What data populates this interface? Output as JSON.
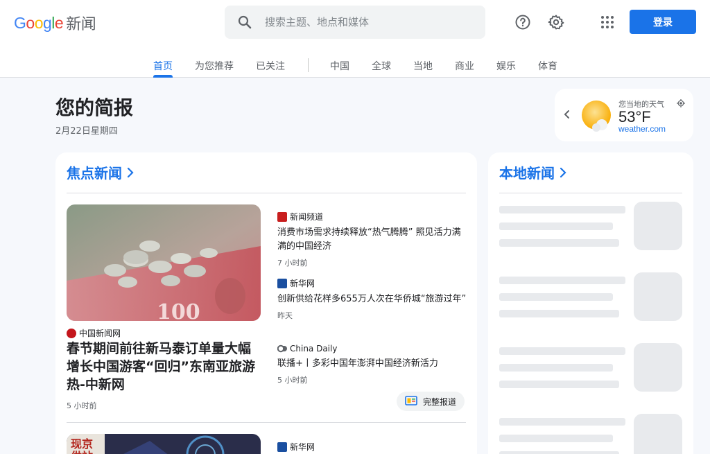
{
  "header": {
    "logo_letters": [
      "G",
      "o",
      "o",
      "g",
      "l",
      "e"
    ],
    "product_name": "新闻",
    "search_placeholder": "搜索主题、地点和媒体",
    "login_label": "登录"
  },
  "tabs": [
    {
      "label": "首页",
      "active": true
    },
    {
      "label": "为您推荐",
      "active": false
    },
    {
      "label": "已关注",
      "active": false
    },
    {
      "label": "中国",
      "active": false
    },
    {
      "label": "全球",
      "active": false
    },
    {
      "label": "当地",
      "active": false
    },
    {
      "label": "商业",
      "active": false
    },
    {
      "label": "娱乐",
      "active": false
    },
    {
      "label": "体育",
      "active": false
    }
  ],
  "briefing": {
    "title": "您的简报",
    "date": "2月22日星期四"
  },
  "weather": {
    "label": "您当地的天气",
    "temperature": "53°F",
    "source": "weather.com"
  },
  "top_stories": {
    "heading": "焦点新闻",
    "hero": {
      "source": "中国新闻网",
      "title": "春节期间前往新马泰订单量大幅增长中国游客“回归”东南亚旅游热-中新网",
      "time": "5 小时前"
    },
    "items": [
      {
        "source": "新闻频道",
        "title": "消费市场需求持续释放“热气腾腾” 照见活力满满的中国经济",
        "time": "7 小时前"
      },
      {
        "source": "新华网",
        "title": "创新供给花样多655万人次在华侨城“旅游过年”",
        "time": "昨天"
      },
      {
        "source": "China Daily",
        "title": "联播+丨多彩中国年澎湃中国经济新活力",
        "time": "5 小时前"
      }
    ],
    "full_coverage_label": "完整报道",
    "next_source": "新华网"
  },
  "local_news": {
    "heading": "本地新闻"
  },
  "colors": {
    "accent": "#1a73e8",
    "background": "#f6f8fc",
    "skeleton": "#e8eaed"
  }
}
